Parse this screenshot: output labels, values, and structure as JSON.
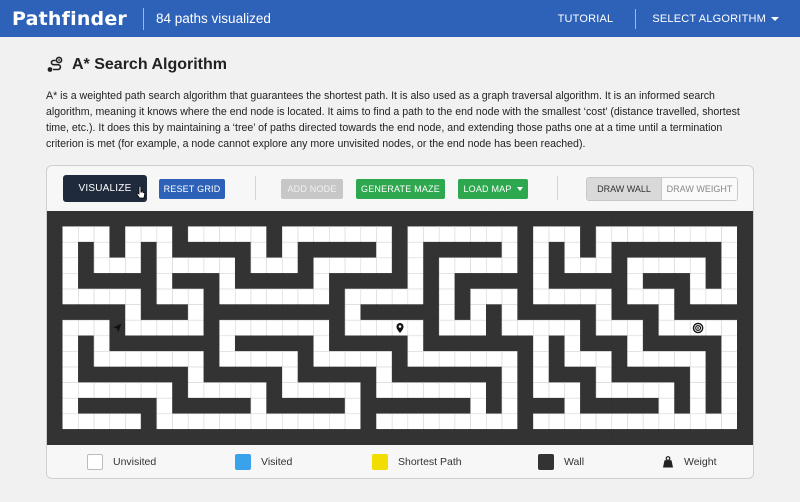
{
  "header": {
    "brand": "Pathfinder",
    "paths_count": "84 paths visualized",
    "tutorial": "TUTORIAL",
    "select_algorithm": "SELECT ALGORITHM"
  },
  "algorithm": {
    "icon": "route-icon",
    "title": "A* Search Algorithm",
    "description": "A* is a weighted path search algorithm that guarantees the shortest path. It is also used as a graph traversal algorithm. It is an informed search algorithm, meaning it knows where the end node is located. It aims to find a path to the end node with the smallest ‘cost’ (distance travelled, shortest time, etc.). It does this by maintaining a ‘tree’ of paths directed towards the end node, and extending those paths one at a time until a termination criterion is met (for example, a node cannot explore any more unvisited nodes, or the end node has been reached)."
  },
  "toolbar": {
    "visualize": "VISUALIZE",
    "reset_grid": "RESET GRID",
    "add_node": "ADD NODE",
    "generate_maze": "GENERATE MAZE",
    "load_map": "LOAD MAP",
    "draw_wall": "DRAW WALL",
    "draw_weight": "DRAW WEIGHT",
    "active_mode": "draw_wall"
  },
  "colors": {
    "header": "#2e62b8",
    "visualize_bg": "#1f2b3d",
    "reset_bg": "#2e62b8",
    "green_btn": "#2ea84e",
    "disabled_btn": "#c7c7c7",
    "wall": "#333333",
    "unvisited": "#ffffff",
    "visited": "#3aa2ea",
    "shortest_path": "#f2dd00",
    "grid_line": "#d6d6d6"
  },
  "grid": {
    "cols": 45,
    "rows": 15,
    "walls": [
      "#############################################",
      "#...#...#.....#.......#.......#...#.........#",
      "#.#.#.#.#####.#.#####.#.#####.#.#.#.#######.#",
      "#.#...#.....#...#.....#.#.....#.#...#.....#.#",
      "#.#####.###.#####.#####.#.#####.#####.###.#.#",
      "#.....#...#.......#.....#.#...#.....#...#...#",
      "#####.###.#########.#####.#.#.#####.###.#####",
      "#...#.....#.......#.....#...#.....#...#.....#",
      "#.#.#######.#####.#####.#######.#.###.#####.#",
      "#.#.......#.....#.....#.......#.#...#.....#.#",
      "#.#######.#####.#####.#######.#.###.#####.#.#",
      "#.......#.....#.....#.......#.#...#.....#.#.#",
      "#.#####.#####.#####.#######.#.###.#####.#.#.#",
      "#.....#.............#.........#.............#",
      "#############################################"
    ],
    "start": {
      "row": 7,
      "col": 4
    },
    "waypoint": {
      "row": 7,
      "col": 22
    },
    "target": {
      "row": 7,
      "col": 41
    }
  },
  "legend": [
    {
      "key": "unvisited",
      "label": "Unvisited"
    },
    {
      "key": "visited",
      "label": "Visited"
    },
    {
      "key": "shortest",
      "label": "Shortest Path"
    },
    {
      "key": "wall",
      "label": "Wall"
    },
    {
      "key": "weight",
      "label": "Weight",
      "icon": "weight-icon"
    }
  ]
}
